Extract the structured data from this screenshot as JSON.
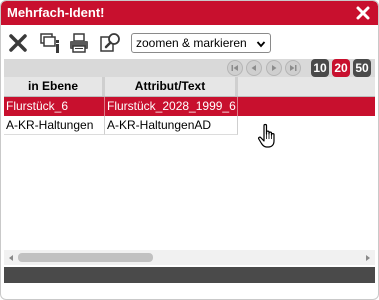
{
  "window": {
    "title": "Mehrfach-Ident!"
  },
  "toolbar": {
    "icons": [
      "close-x-icon",
      "layer-info-icon",
      "print-icon",
      "zoom-search-icon"
    ],
    "zoom_select_value": "zoomen & markieren"
  },
  "pager": {
    "nav_icons": [
      "first-page-icon",
      "previous-page-icon",
      "next-page-icon",
      "last-page-icon"
    ],
    "page_sizes": [
      "10",
      "20",
      "50"
    ],
    "active_page_size": "20",
    "colors": {
      "inactive": "#4a4a4a",
      "active": "#c8102e"
    }
  },
  "table": {
    "columns": [
      "in Ebene",
      "Attribut/Text"
    ],
    "rows": [
      {
        "ebene": "Flurstück_6",
        "attribut": "Flurstück_2028_1999_6",
        "selected": true
      },
      {
        "ebene": "A-KR-Haltungen",
        "attribut": "A-KR-HaltungenAD",
        "selected": false
      }
    ]
  },
  "colors": {
    "accent": "#c8102e",
    "footer": "#4a4a4a"
  }
}
